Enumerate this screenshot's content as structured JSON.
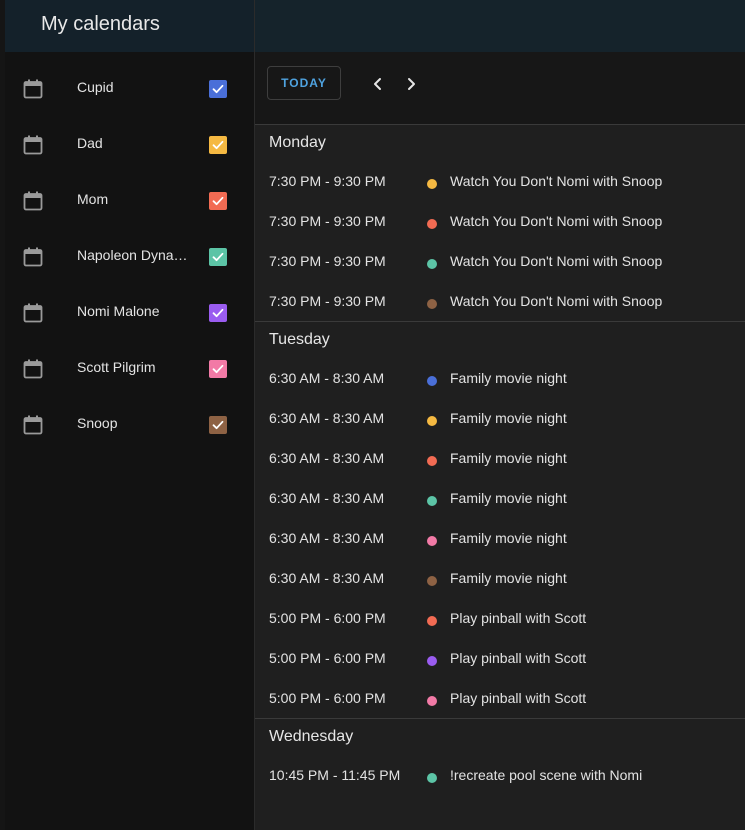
{
  "sidebar": {
    "title": "My calendars",
    "calendars": [
      {
        "name": "Cupid",
        "color": "#4a6fd8",
        "checked": true
      },
      {
        "name": "Dad",
        "color": "#f5b942",
        "checked": true
      },
      {
        "name": "Mom",
        "color": "#f26b53",
        "checked": true
      },
      {
        "name": "Napoleon Dynamite",
        "color": "#5cc4a6",
        "checked": true
      },
      {
        "name": "Nomi Malone",
        "color": "#9a5cf0",
        "checked": true
      },
      {
        "name": "Scott Pilgrim",
        "color": "#f27aa6",
        "checked": true
      },
      {
        "name": "Snoop",
        "color": "#8e6244",
        "checked": true
      }
    ]
  },
  "toolbar": {
    "today_label": "TODAY",
    "prev_icon": "chevron-left-icon",
    "next_icon": "chevron-right-icon"
  },
  "days": [
    {
      "label": "Monday",
      "events": [
        {
          "time": "7:30 PM - 9:30 PM",
          "title": "Watch You Don't Nomi with Snoop",
          "color": "#f5b942"
        },
        {
          "time": "7:30 PM - 9:30 PM",
          "title": "Watch You Don't Nomi with Snoop",
          "color": "#f26b53"
        },
        {
          "time": "7:30 PM - 9:30 PM",
          "title": "Watch You Don't Nomi with Snoop",
          "color": "#5cc4a6"
        },
        {
          "time": "7:30 PM - 9:30 PM",
          "title": "Watch You Don't Nomi with Snoop",
          "color": "#8e6244"
        }
      ]
    },
    {
      "label": "Tuesday",
      "events": [
        {
          "time": "6:30 AM - 8:30 AM",
          "title": "Family movie night",
          "color": "#4a6fd8"
        },
        {
          "time": "6:30 AM - 8:30 AM",
          "title": "Family movie night",
          "color": "#f5b942"
        },
        {
          "time": "6:30 AM - 8:30 AM",
          "title": "Family movie night",
          "color": "#f26b53"
        },
        {
          "time": "6:30 AM - 8:30 AM",
          "title": "Family movie night",
          "color": "#5cc4a6"
        },
        {
          "time": "6:30 AM - 8:30 AM",
          "title": "Family movie night",
          "color": "#f27aa6"
        },
        {
          "time": "6:30 AM - 8:30 AM",
          "title": "Family movie night",
          "color": "#8e6244"
        },
        {
          "time": "5:00 PM - 6:00 PM",
          "title": "Play pinball with Scott",
          "color": "#f26b53"
        },
        {
          "time": "5:00 PM - 6:00 PM",
          "title": "Play pinball with Scott",
          "color": "#9a5cf0"
        },
        {
          "time": "5:00 PM - 6:00 PM",
          "title": "Play pinball with Scott",
          "color": "#f27aa6"
        }
      ]
    },
    {
      "label": "Wednesday",
      "events": [
        {
          "time": "10:45 PM - 11:45 PM",
          "title": "!recreate pool scene with Nomi",
          "color": "#5cc4a6"
        }
      ]
    }
  ]
}
